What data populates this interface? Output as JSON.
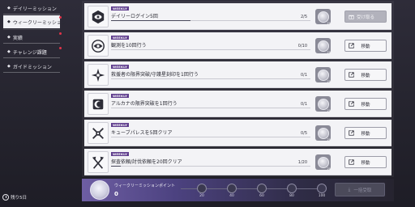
{
  "sidebar": {
    "items": [
      {
        "label": "デイリーミッション",
        "active": false,
        "dot": false
      },
      {
        "label": "ウィークリーミッション",
        "active": true,
        "dot": true
      },
      {
        "label": "実績",
        "active": false,
        "dot": true
      },
      {
        "label": "チャレンジ課題",
        "active": false,
        "dot": true
      },
      {
        "label": "ガイドミッション",
        "active": false,
        "dot": false
      }
    ],
    "remaining": "残り5日"
  },
  "missions": [
    {
      "tag": "WEEKLY",
      "title": "デイリーログイン5回",
      "progress": "2/5",
      "fraction": 0.4,
      "reward_qty": "20",
      "button": "受け取る",
      "button_enabled": false,
      "icon": "hexagon-eye-icon"
    },
    {
      "tag": "WEEKLY",
      "title": "観測を10回行う",
      "progress": "0/10",
      "fraction": 0,
      "reward_qty": "20",
      "button": "移動",
      "button_enabled": true,
      "icon": "spiral-eye-icon"
    },
    {
      "tag": "WEEKLY",
      "title": "救援者の限界突破/守護星刻印を1回行う",
      "progress": "0/1",
      "fraction": 0,
      "reward_qty": "20",
      "button": "移動",
      "button_enabled": true,
      "icon": "star-burst-icon"
    },
    {
      "tag": "WEEKLY",
      "title": "アルカナの限界突破を1回行う",
      "progress": "0/1",
      "fraction": 0,
      "reward_qty": "20",
      "button": "移動",
      "button_enabled": true,
      "icon": "crescent-icon"
    },
    {
      "tag": "WEEKLY",
      "title": "キューブパレスを5回クリア",
      "progress": "0/5",
      "fraction": 0,
      "reward_qty": "20",
      "button": "移動",
      "button_enabled": true,
      "icon": "crossed-swords-icon"
    },
    {
      "tag": "WEEKLY",
      "title": "探査依頼/討伐依頼を20回クリア",
      "progress": "1/20",
      "fraction": 0.05,
      "reward_qty": "20",
      "button": "移動",
      "button_enabled": true,
      "icon": "crossed-axes-icon"
    }
  ],
  "points": {
    "label": "ウィークリーミッションポイント",
    "value": "0",
    "milestones": [
      "20",
      "40",
      "60",
      "80",
      "100"
    ],
    "bulk_button": "一括受取"
  }
}
